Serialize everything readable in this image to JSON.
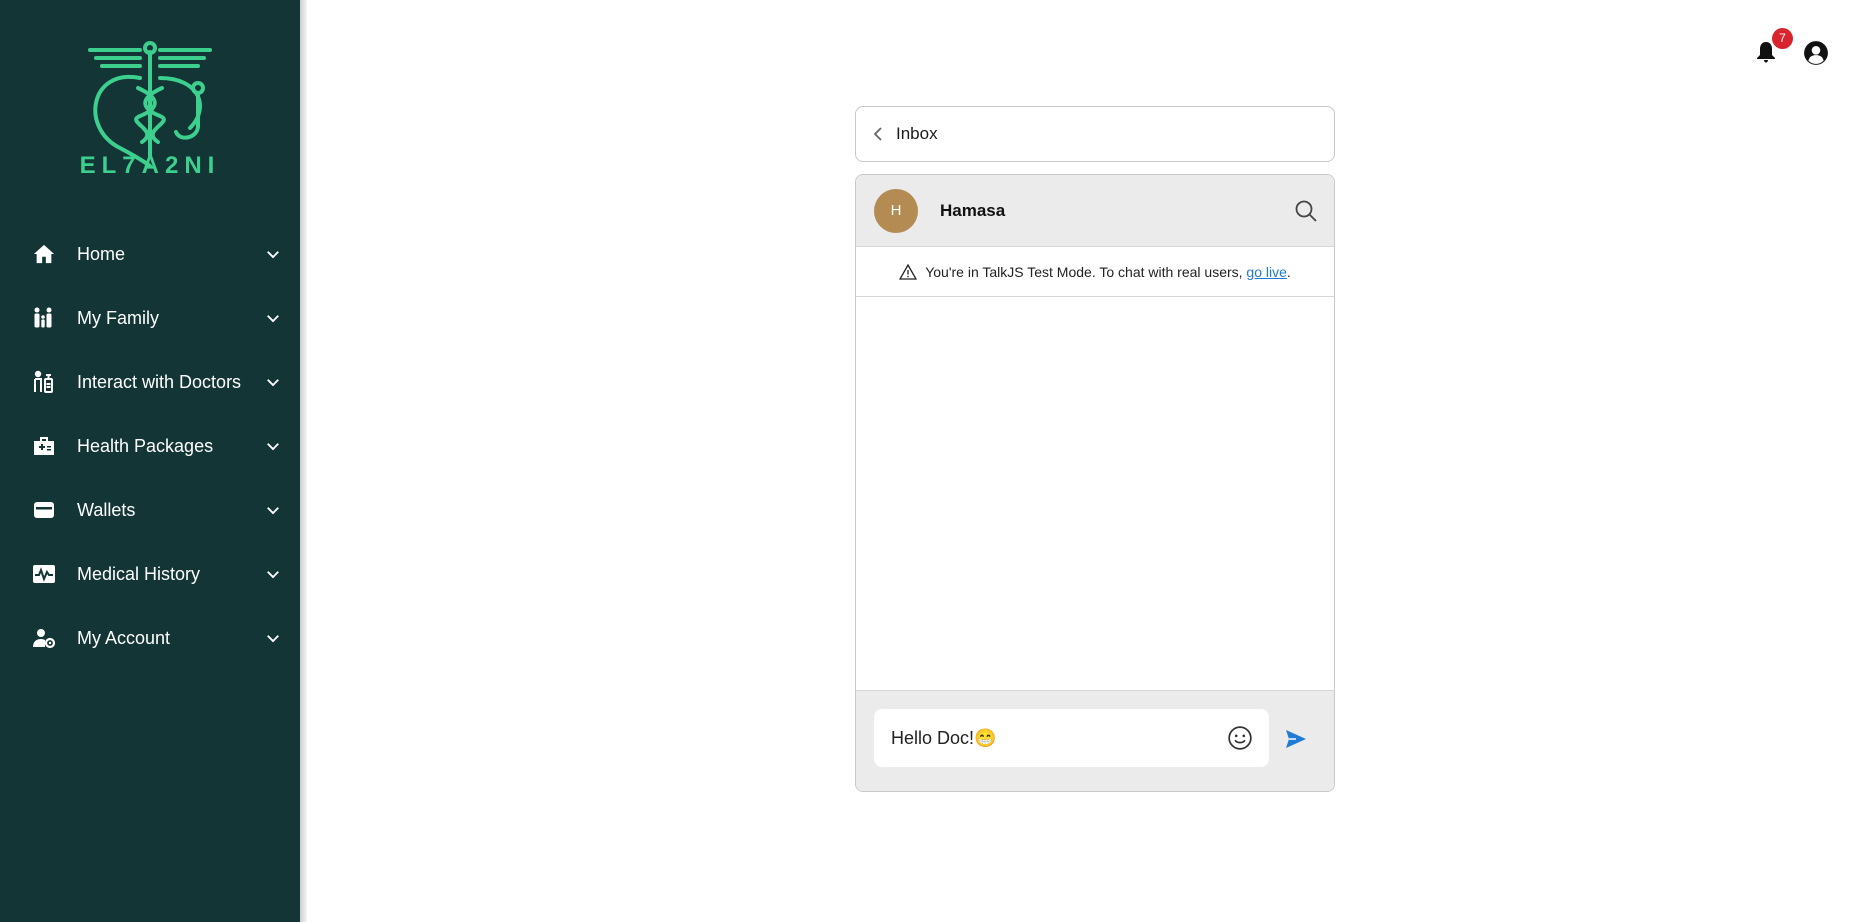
{
  "brand": {
    "logo_text": "EL7A2NI"
  },
  "sidebar": {
    "items": [
      {
        "label": "Home",
        "icon": "home-icon"
      },
      {
        "label": "My Family",
        "icon": "family-icon"
      },
      {
        "label": "Interact with Doctors",
        "icon": "doctor-icon"
      },
      {
        "label": "Health Packages",
        "icon": "medical-kit-icon"
      },
      {
        "label": "Wallets",
        "icon": "wallet-icon"
      },
      {
        "label": "Medical History",
        "icon": "heartbeat-chart-icon"
      },
      {
        "label": "My Account",
        "icon": "user-settings-icon"
      }
    ]
  },
  "topbar": {
    "notification_count": "7"
  },
  "inbox": {
    "label": "Inbox"
  },
  "chat": {
    "avatar_initial": "H",
    "name": "Hamasa",
    "banner_text": "You're in TalkJS Test Mode. To chat with real users, ",
    "banner_link": "go live",
    "banner_end": ".",
    "input_value": "Hello Doc!",
    "input_emoji": "😁"
  },
  "colors": {
    "sidebar_bg": "#133536",
    "brand_green": "#3ccf8e",
    "badge_red": "#d8242c",
    "link_blue": "#1f7bd6",
    "avatar_bg": "#b58b54"
  }
}
